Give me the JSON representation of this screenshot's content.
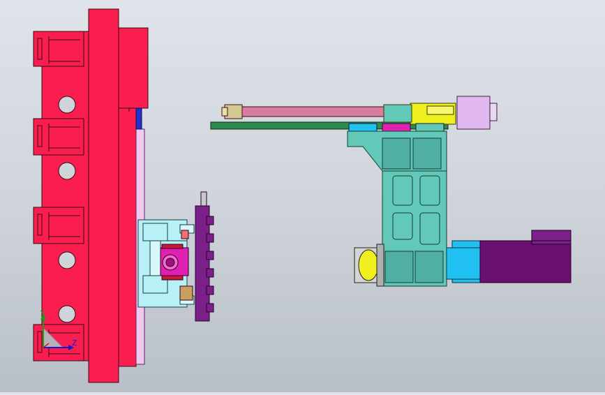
{
  "viewport": {
    "background_top": "#dfe4ea",
    "background_bottom": "#b9bfc6"
  },
  "colors": {
    "frame_red": "#fa1e50",
    "frame_outline": "#3a0a14",
    "rail_pink": "#f0c8f0",
    "rail_blue": "#2030c8",
    "teal_body": "#62c8b8",
    "teal_dark": "#2f8c80",
    "rod_pink": "#d87ca0",
    "plate_green": "#2e8a4a",
    "yellow_block": "#f0f020",
    "lilac_motor": "#e2b8f0",
    "purple_motor": "#6a1070",
    "cyan_coupler": "#20c0f0",
    "gripper_purple": "#7a2088",
    "cyan_fixture": "#b8f0f8",
    "magenta": "#e020b0"
  },
  "triad": {
    "y_label": "Y",
    "z_label": "Z",
    "x_label": "X"
  }
}
